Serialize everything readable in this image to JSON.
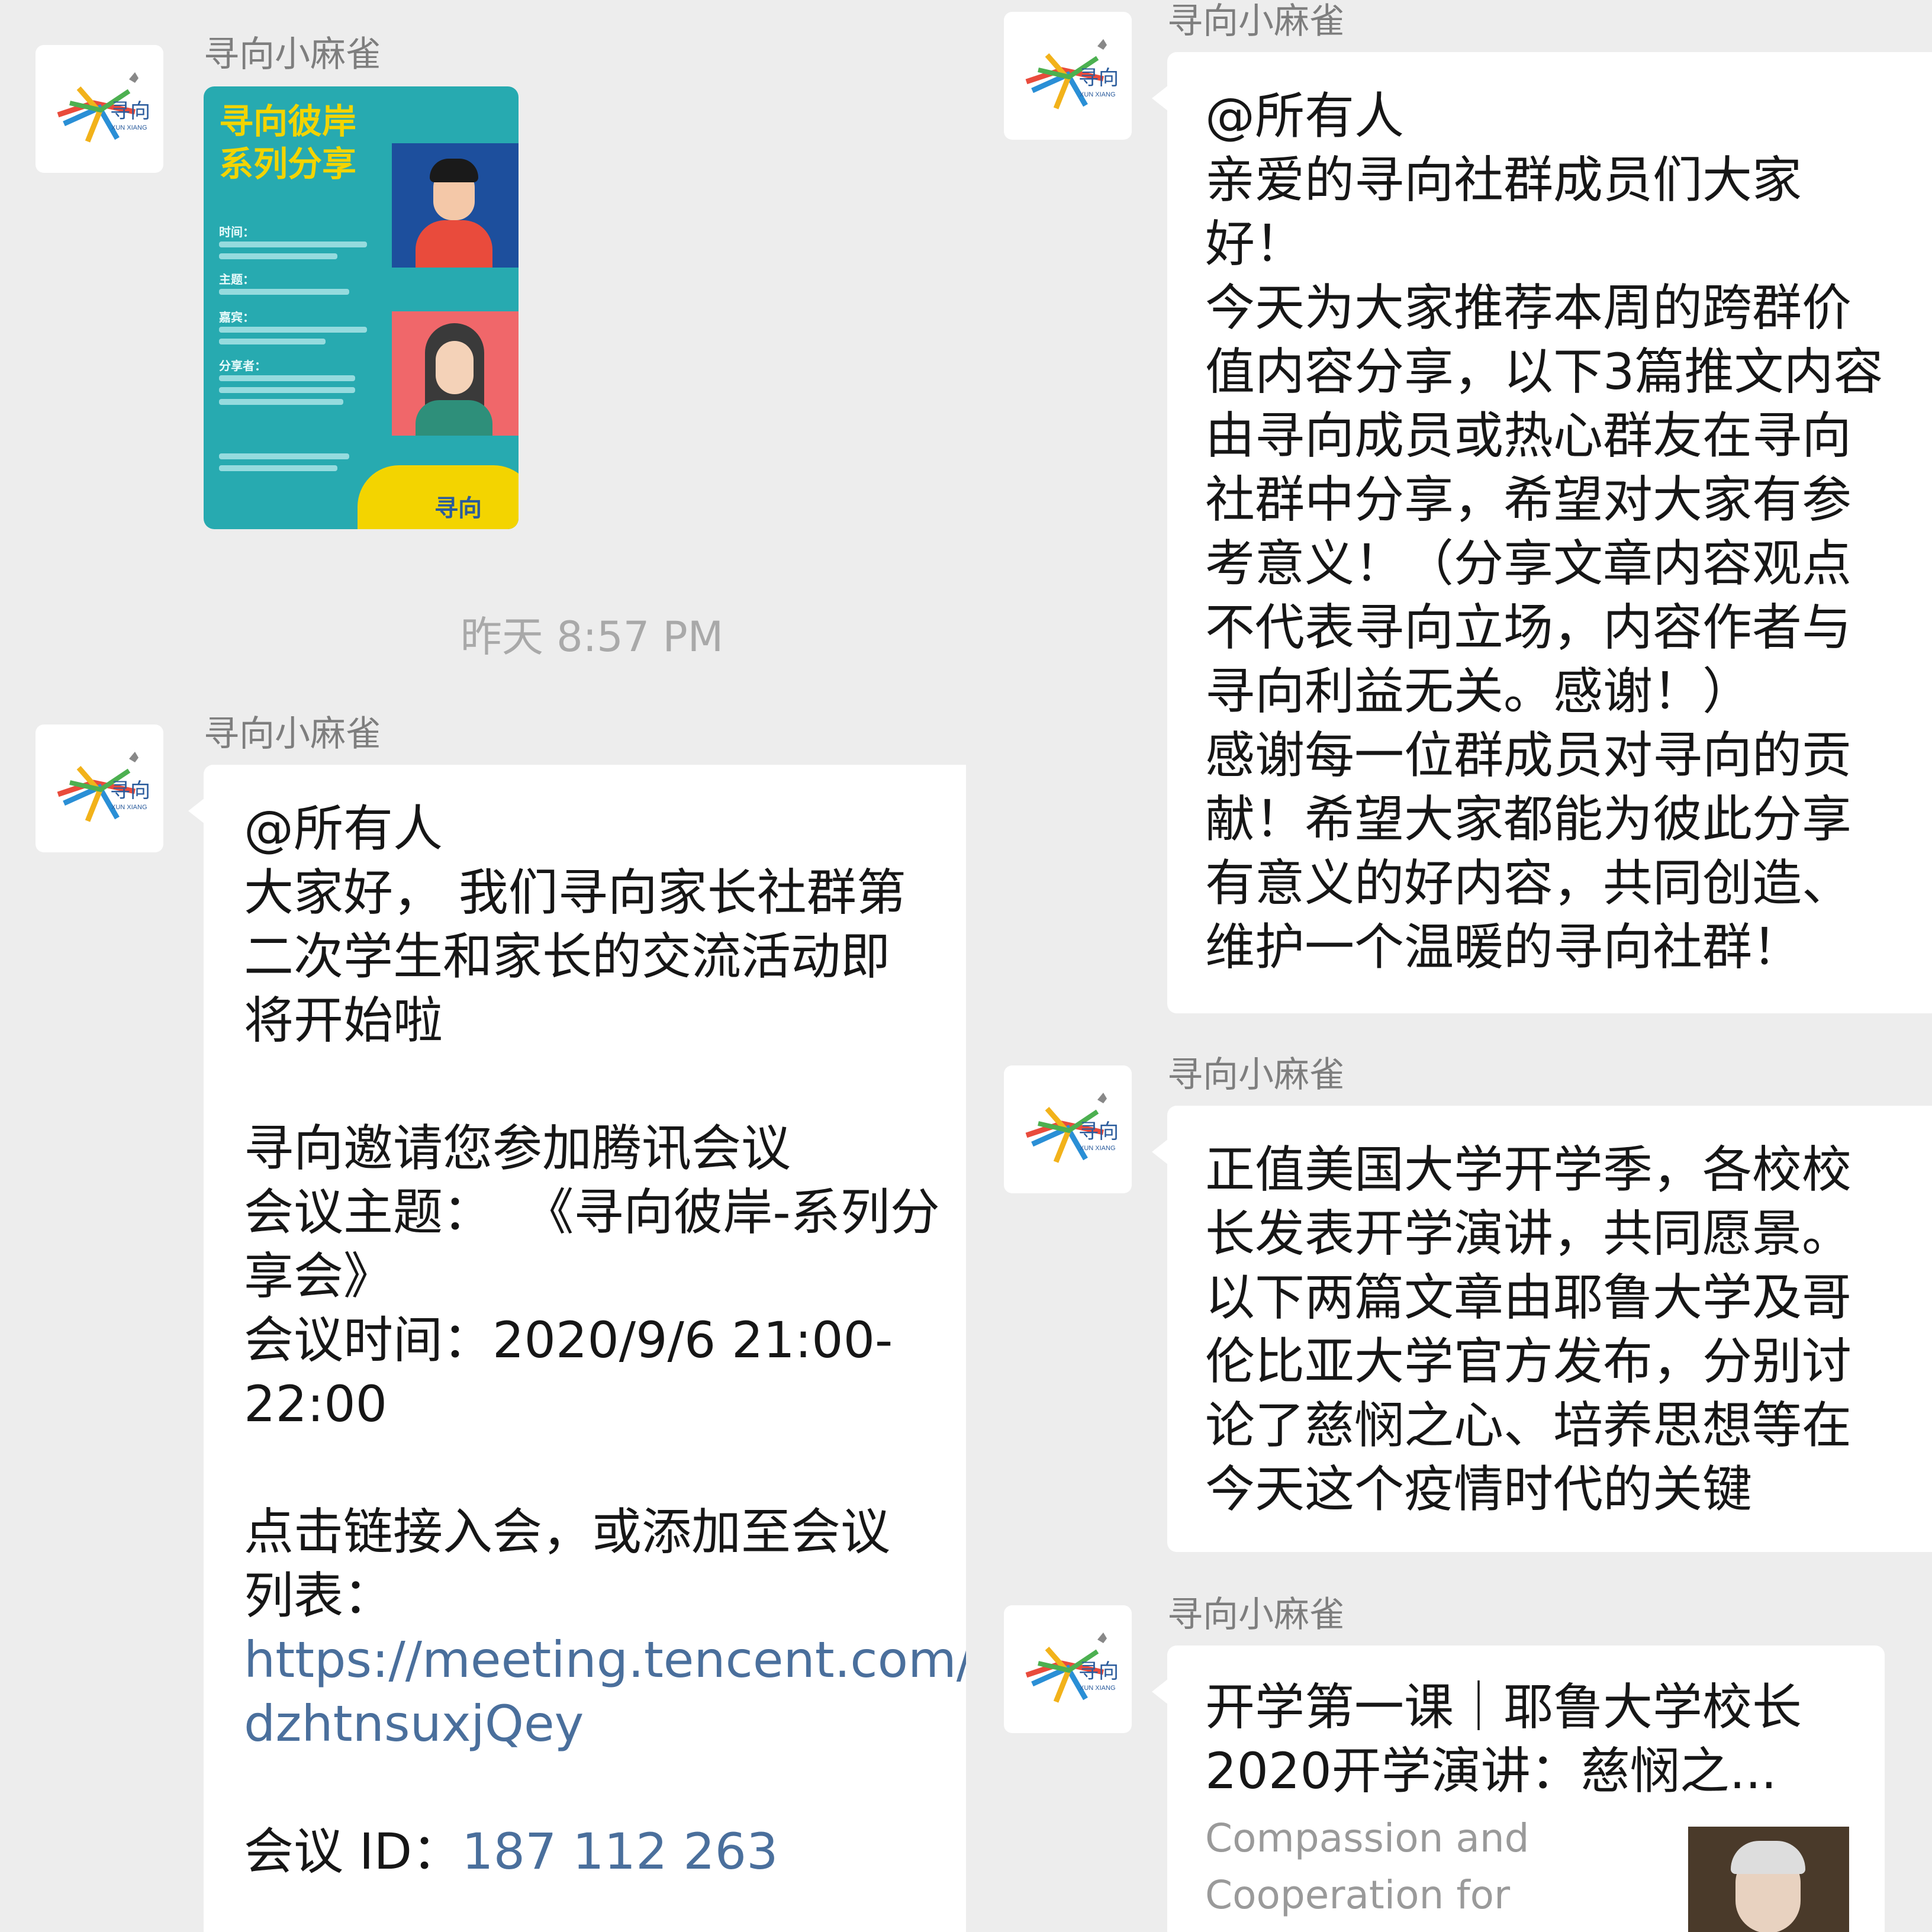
{
  "brand": {
    "logo_text": "寻向",
    "logo_sub": "XUN XIANG"
  },
  "left": {
    "messages": [
      {
        "sender": "寻向小麻雀",
        "type": "image",
        "poster": {
          "title_line1": "寻向彼岸",
          "title_line2": "系列分享",
          "label_time": "时间：",
          "label_topic": "主题：",
          "label_guest": "嘉宾：",
          "label_share": "分享者：",
          "footer_logo": "寻向"
        }
      }
    ],
    "timestamp": "昨天 8:57 PM",
    "message2": {
      "sender": "寻向小麻雀",
      "lines": [
        "@所有人",
        "大家好， 我们寻向家长社群第",
        "二次学生和家长的交流活动即",
        "将开始啦",
        "",
        "寻向邀请您参加腾讯会议",
        "会议主题：  《寻向彼岸-系列分",
        "享会》",
        "会议时间：2020/9/6 21:00-",
        "22:00",
        "",
        "点击链接入会，或添加至会议",
        "列表："
      ],
      "link_line1": "https://meeting.tencent.com/s",
      "link_line2": "dzhtnsuxjQey",
      "meeting_id_label": "会议 ID：",
      "meeting_id_value": "187 112 263"
    }
  },
  "right": {
    "message1": {
      "sender": "寻向小麻雀",
      "lines": [
        "@所有人",
        "亲爱的寻向社群成员们大家",
        "好！",
        "今天为大家推荐本周的跨群价",
        "值内容分享，以下3篇推文内容",
        "由寻向成员或热心群友在寻向",
        "社群中分享，希望对大家有参",
        "考意义！（分享文章内容观点",
        "不代表寻向立场，内容作者与",
        "寻向利益无关。感谢！）",
        "感谢每一位群成员对寻向的贡",
        "献！希望大家都能为彼此分享",
        "有意义的好内容，共同创造、",
        "维护一个温暖的寻向社群！"
      ]
    },
    "message2": {
      "sender": "寻向小麻雀",
      "lines": [
        "正值美国大学开学季，各校校",
        "长发表开学演讲，共同愿景。",
        "以下两篇文章由耶鲁大学及哥",
        "伦比亚大学官方发布，分别讨",
        "论了慈悯之心、培养思想等在",
        "今天这个疫情时代的关键"
      ]
    },
    "message3": {
      "sender": "寻向小麻雀",
      "article_title_line1": "开学第一课｜耶鲁大学校长",
      "article_title_line2": "2020开学演讲：慈悯之...",
      "article_desc_line1": "Compassion and",
      "article_desc_line2": "Cooperation for"
    }
  }
}
